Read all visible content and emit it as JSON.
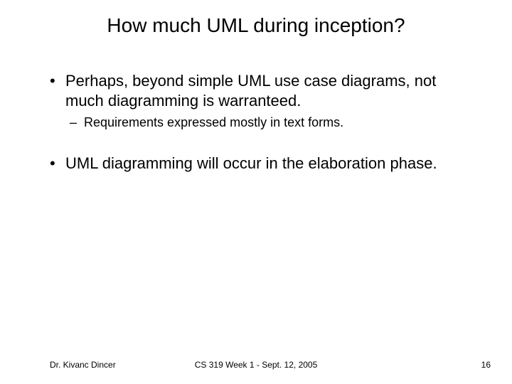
{
  "title": "How much UML during inception?",
  "bullets": [
    {
      "level": 1,
      "text": "Perhaps, beyond simple UML use case diagrams, not much diagramming is warranteed."
    },
    {
      "level": 2,
      "text": "Requirements expressed mostly in text forms."
    },
    {
      "level": 1,
      "text": "UML diagramming will occur in the elaboration phase."
    }
  ],
  "footer": {
    "left": "Dr. Kivanc Dincer",
    "center": "CS 319 Week 1 - Sept. 12, 2005",
    "right": "16"
  }
}
